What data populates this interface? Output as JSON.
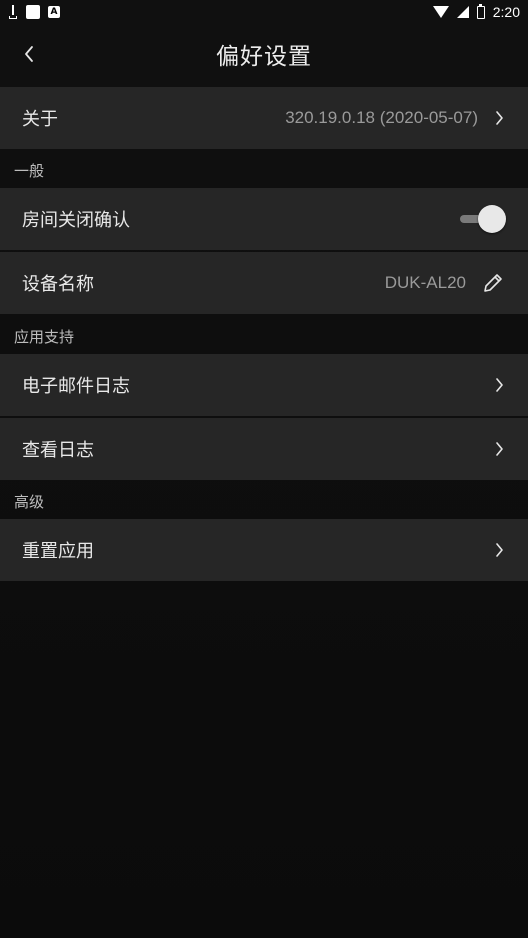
{
  "status_bar": {
    "time": "2:20",
    "icons": [
      "usb-icon",
      "notification-square-icon",
      "app-notification-icon",
      "wifi-icon",
      "signal-icon",
      "battery-icon"
    ],
    "app_icon_letter": "A"
  },
  "header": {
    "title": "偏好设置",
    "back_icon": "chevron-left-icon"
  },
  "about": {
    "label": "关于",
    "value": "320.19.0.18 (2020-05-07)"
  },
  "sections": {
    "general": {
      "title": "一般",
      "room_close_confirm": {
        "label": "房间关闭确认",
        "enabled": true
      },
      "device_name": {
        "label": "设备名称",
        "value": "DUK-AL20"
      }
    },
    "app_support": {
      "title": "应用支持",
      "email_log": {
        "label": "电子邮件日志"
      },
      "view_log": {
        "label": "查看日志"
      }
    },
    "advanced": {
      "title": "高级",
      "reset_app": {
        "label": "重置应用"
      }
    }
  },
  "colors": {
    "background": "#0d0d0d",
    "row_background": "#262626",
    "text": "#e8e8e8",
    "muted_text": "#9a9a9a"
  }
}
